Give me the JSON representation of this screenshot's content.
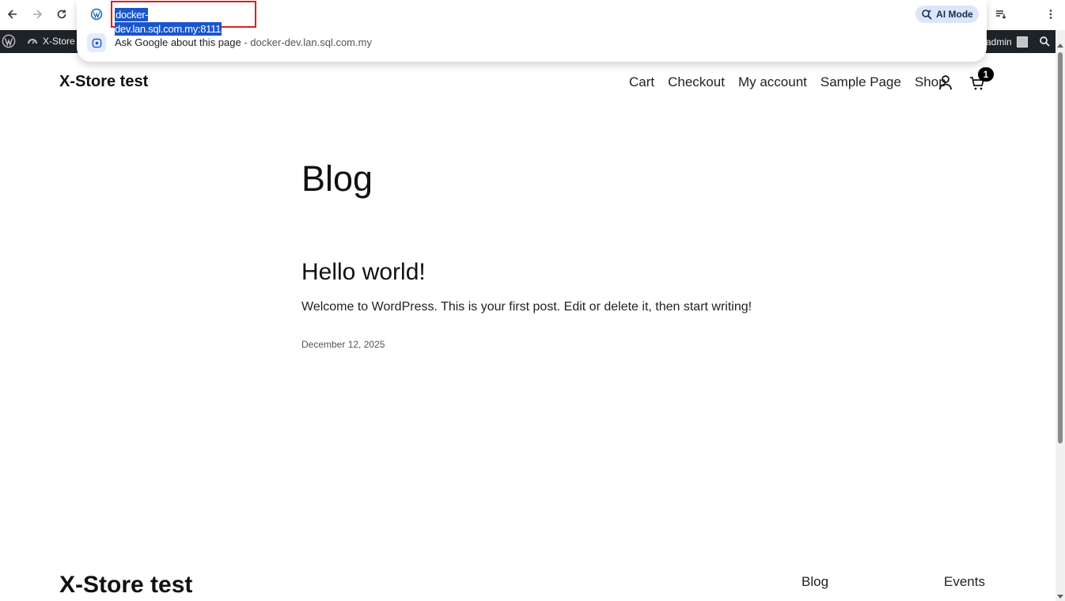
{
  "browser": {
    "url": "docker-dev.lan.sql.com.my:8111",
    "ai_mode_label": "AI Mode",
    "suggestion_text": "Ask Google about this page",
    "suggestion_separator": " - ",
    "suggestion_domain": "docker-dev.lan.sql.com.my"
  },
  "admin_bar": {
    "site_name": "X-Store",
    "user": "admin"
  },
  "site": {
    "title": "X-Store test",
    "nav": [
      "Cart",
      "Checkout",
      "My account",
      "Sample Page",
      "Shop"
    ],
    "cart_count": "1"
  },
  "main": {
    "heading": "Blog",
    "post": {
      "title": "Hello world!",
      "excerpt": "Welcome to WordPress. This is your first post. Edit or delete it, then start writing!",
      "date": "December 12, 2025"
    }
  },
  "footer": {
    "title": "X-Store test",
    "links": [
      "Blog",
      "Events"
    ]
  },
  "icons": {
    "back": "back-arrow-icon",
    "forward": "forward-arrow-icon",
    "reload": "reload-icon",
    "wordpress": "wordpress-icon",
    "lens": "google-lens-icon",
    "account": "user-icon",
    "cart": "cart-icon"
  },
  "colors": {
    "url_highlight": "#1a56c9",
    "url_outline": "#d92020",
    "admin_bar": "#1d2327",
    "ai_mode_bg": "#dbe6fb"
  }
}
